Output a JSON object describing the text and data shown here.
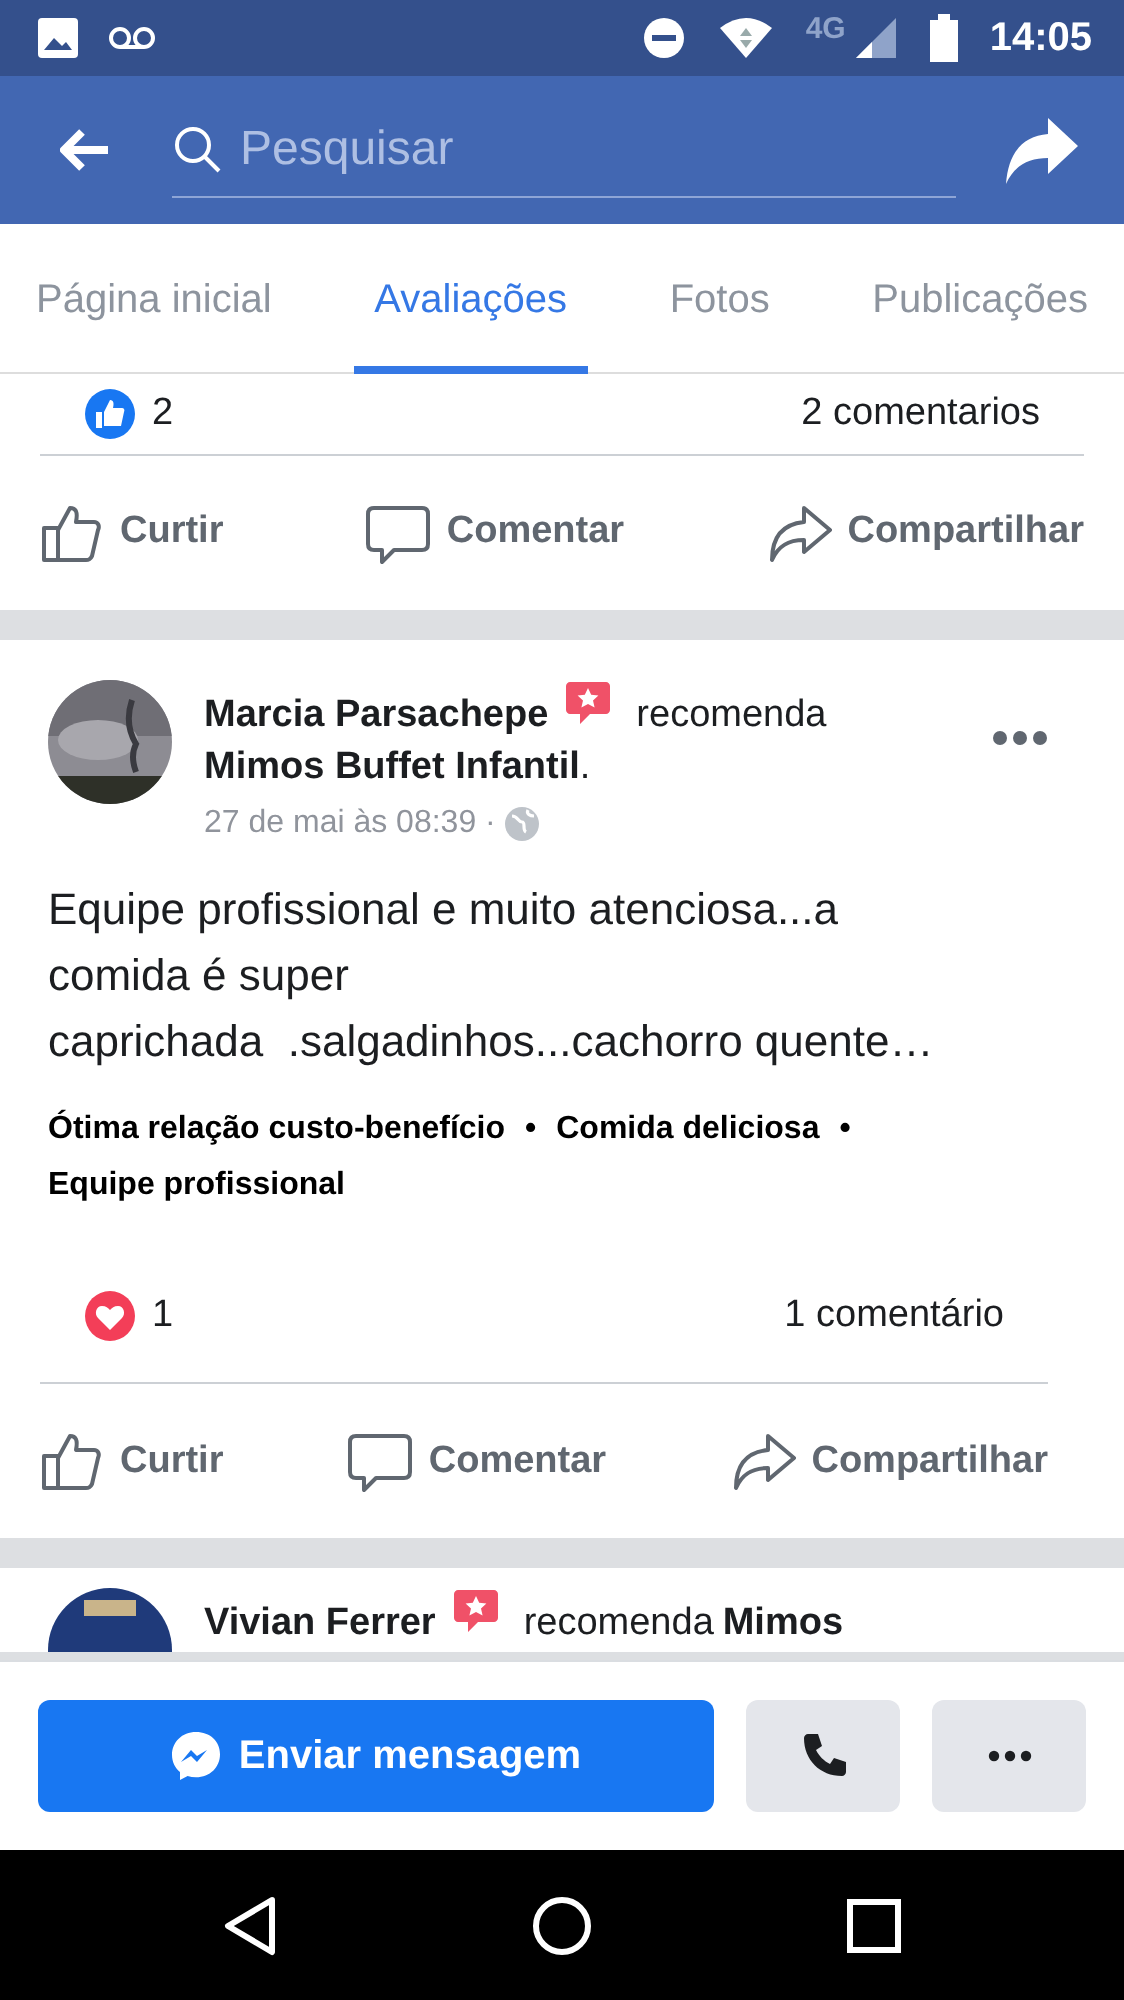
{
  "status_bar": {
    "network": "4G",
    "time": "14:05"
  },
  "search": {
    "placeholder": "Pesquisar"
  },
  "tabs": [
    {
      "label": "Página inicial",
      "selected": false
    },
    {
      "label": "Avaliações",
      "selected": true
    },
    {
      "label": "Fotos",
      "selected": false
    },
    {
      "label": "Publicações",
      "selected": false
    }
  ],
  "posts": [
    {
      "kind": "stub",
      "reaction": {
        "kind": "like",
        "count": "2"
      },
      "comments": "2 comentarios",
      "actions": [
        "Curtir",
        "Comentar",
        "Compartilhar"
      ]
    },
    {
      "kind": "full",
      "author": "Marcia Parsachepe",
      "verb": "recomenda",
      "page": "**Mimos Buffet Infantil**.",
      "time": "27 de mai às 08:39 ·",
      "text": "Equipe profissional e muito atenciosa...a comida é super\ncaprichada  .salgadinhos...cachorro quente…",
      "tags": [
        "Ótima relação custo-benefício",
        "Comida deliciosa",
        "Equipe profissional"
      ],
      "tag_separator": "•",
      "reaction": {
        "kind": "love",
        "count": "1"
      },
      "comments": "1 comentário",
      "actions": [
        "Curtir",
        "Comentar",
        "Compartilhar"
      ]
    },
    {
      "kind": "partial",
      "author": "Vivian Ferrer",
      "verb": "recomenda",
      "page": "**Mimos**"
    }
  ],
  "bottom_bar": {
    "message_button": "Enviar mensagem"
  }
}
